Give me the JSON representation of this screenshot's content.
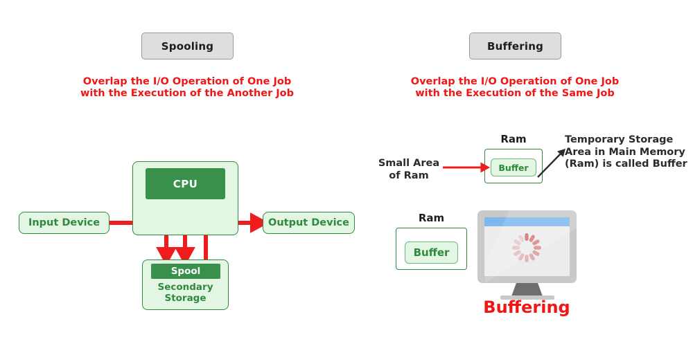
{
  "page": {
    "title": "Spooling vs Buffering",
    "background": "#ffffff"
  },
  "colors": {
    "red": "#f01616",
    "green_dark": "#2f8a3e",
    "green_chip": "#38904a",
    "green_light": "#e3f5e3",
    "gray_header_bg": "#dedede",
    "gray_header_border": "#9a9a9a",
    "text_dark": "#2b2b2b",
    "monitor_bezel": "#c9c9c9",
    "monitor_titlebar": "#7fb8ef",
    "monitor_screen": "#ececec",
    "spinner": "#e08f8f"
  },
  "left_panel": {
    "header": "Spooling",
    "caption": "Overlap the I/O Operation of One Job with the Execution of the Another Job",
    "cpu_chip_label": "CPU",
    "input_device_label": "Input Device",
    "output_device_label": "Output Device",
    "spool_chip_label": "Spool",
    "secondary_storage_label": "Secondary Storage"
  },
  "right_panel": {
    "header": "Buffering",
    "caption": "Overlap the I/O Operation of One Job with the Execution of the Same Job",
    "ram_label_top": "Ram",
    "buffer_label_top": "Buffer",
    "ram_label_bottom": "Ram",
    "buffer_label_bottom": "Buffer",
    "small_area_text": "Small Area of Ram",
    "annotation_text": "Temporary Storage Area in Main Memory (Ram) is called Buffer",
    "buffering_word": "Buffering"
  },
  "icons": {
    "monitor": "monitor-icon",
    "spinner": "loading-spinner-icon",
    "arrow_red": "red-arrow-icon",
    "arrow_black": "black-pointer-arrow-icon"
  }
}
